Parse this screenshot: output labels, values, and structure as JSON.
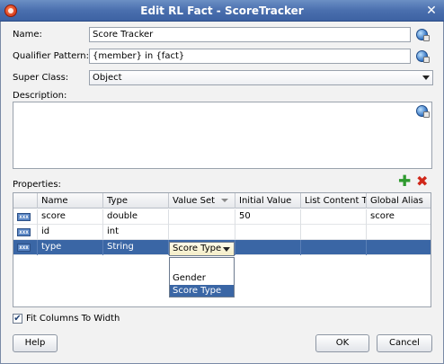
{
  "window": {
    "title": "Edit RL Fact - ScoreTracker",
    "close_label": "✕"
  },
  "form": {
    "name_label": "Name:",
    "name_value": "Score Tracker",
    "qualifier_label": "Qualifier Pattern:",
    "qualifier_value": "{member} in {fact}",
    "superclass_label": "Super Class:",
    "superclass_value": "Object",
    "description_label": "Description:",
    "description_value": ""
  },
  "properties": {
    "label": "Properties:",
    "columns": [
      "",
      "Name",
      "Type",
      "Value Set",
      "Initial Value",
      "List Content Ty",
      "Global Alias"
    ],
    "rows": [
      {
        "icon": "xxx",
        "name": "score",
        "type": "double",
        "value_set": "",
        "initial_value": "50",
        "list_content": "",
        "global_alias": "score"
      },
      {
        "icon": "xxx",
        "name": "id",
        "type": "int",
        "value_set": "",
        "initial_value": "",
        "list_content": "",
        "global_alias": ""
      },
      {
        "icon": "xxx",
        "name": "type",
        "type": "String",
        "value_set": "Score Type",
        "initial_value": "",
        "list_content": "",
        "global_alias": ""
      }
    ],
    "dropdown_options": [
      "",
      "Gender",
      "Score Type"
    ],
    "dropdown_selected": "Score Type"
  },
  "fit_columns": {
    "label": "Fit Columns To Width",
    "checked": true
  },
  "buttons": {
    "help": "Help",
    "ok": "OK",
    "cancel": "Cancel"
  }
}
